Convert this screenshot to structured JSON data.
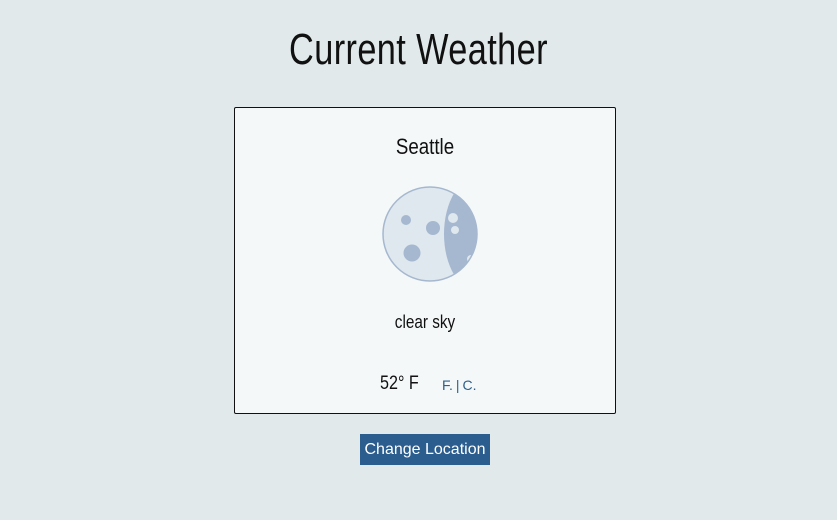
{
  "header": {
    "title": "Current Weather"
  },
  "card": {
    "city": "Seattle",
    "icon": "moon-icon",
    "condition": "clear sky",
    "temperature": "52° F",
    "units": {
      "fahrenheit_label": "F.",
      "separator": "|",
      "celsius_label": "C."
    }
  },
  "actions": {
    "change_location_label": "Change Location"
  },
  "colors": {
    "background": "#e1e9ea",
    "card_background": "#f4f8f9",
    "button": "#2b5d8f",
    "link": "#2f5f8a",
    "moon_light": "#dfe7ef",
    "moon_shadow": "#a6b8cf"
  }
}
